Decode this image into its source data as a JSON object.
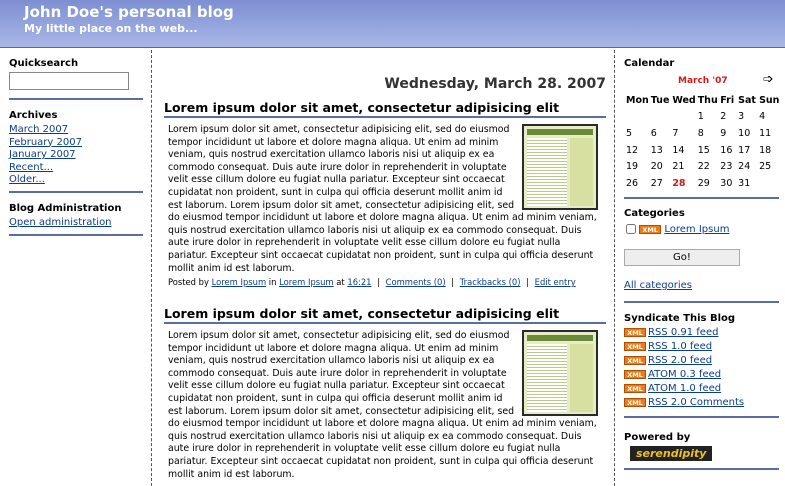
{
  "header": {
    "title": "John Doe's personal blog",
    "description": "My little place on the web..."
  },
  "left": {
    "quicksearch_title": "Quicksearch",
    "search_value": "",
    "archives_title": "Archives",
    "archives": [
      "March 2007",
      "February 2007",
      "January 2007",
      "Recent...",
      "Older..."
    ],
    "admin_title": "Blog Administration",
    "admin_link": "Open administration"
  },
  "main": {
    "date": "Wednesday, March 28. 2007",
    "entries": [
      {
        "title": "Lorem ipsum dolor sit amet, consectetur adipisicing elit",
        "body": "Lorem ipsum dolor sit amet, consectetur adipisicing elit, sed do eiusmod tempor incididunt ut labore et dolore magna aliqua. Ut enim ad minim veniam, quis nostrud exercitation ullamco laboris nisi ut aliquip ex ea commodo consequat. Duis aute irure dolor in reprehenderit in voluptate velit esse cillum dolore eu fugiat nulla pariatur. Excepteur sint occaecat cupidatat non proident, sunt in culpa qui officia deserunt mollit anim id est laborum. Lorem ipsum dolor sit amet, consectetur adipisicing elit, sed do eiusmod tempor incididunt ut labore et dolore magna aliqua. Ut enim ad minim veniam, quis nostrud exercitation ullamco laboris nisi ut aliquip ex ea commodo consequat. Duis aute irure dolor in reprehenderit in voluptate velit esse cillum dolore eu fugiat nulla pariatur. Excepteur sint occaecat cupidatat non proident, sunt in culpa qui officia deserunt mollit anim id est laborum.",
        "footer": {
          "posted_by": "Posted by",
          "author": "Lorem Ipsum",
          "in": "in",
          "category": "Lorem Ipsum",
          "at": "at",
          "time": "16:21",
          "comments": "Comments (0)",
          "trackbacks": "Trackbacks (0)",
          "edit": "Edit entry"
        }
      },
      {
        "title": "Lorem ipsum dolor sit amet, consectetur adipisicing elit",
        "body": "Lorem ipsum dolor sit amet, consectetur adipisicing elit, sed do eiusmod tempor incididunt ut labore et dolore magna aliqua. Ut enim ad minim veniam, quis nostrud exercitation ullamco laboris nisi ut aliquip ex ea commodo consequat. Duis aute irure dolor in reprehenderit in voluptate velit esse cillum dolore eu fugiat nulla pariatur. Excepteur sint occaecat cupidatat non proident, sunt in culpa qui officia deserunt mollit anim id est laborum. Lorem ipsum dolor sit amet, consectetur adipisicing elit, sed do eiusmod tempor incididunt ut labore et dolore magna aliqua. Ut enim ad minim veniam, quis nostrud exercitation ullamco laboris nisi ut aliquip ex ea commodo consequat. Duis aute irure dolor in reprehenderit in voluptate velit esse cillum dolore eu fugiat nulla pariatur. Excepteur sint occaecat cupidatat non proident, sunt in culpa qui officia deserunt mollit anim id est laborum."
      }
    ]
  },
  "right": {
    "calendar_title": "Calendar",
    "calendar_month": "March '07",
    "next_icon": "arrow-right-icon",
    "weekdays": [
      "Mon",
      "Tue",
      "Wed",
      "Thu",
      "Fri",
      "Sat",
      "Sun"
    ],
    "weeks": [
      [
        "",
        "",
        "",
        "1",
        "2",
        "3",
        "4"
      ],
      [
        "5",
        "6",
        "7",
        "8",
        "9",
        "10",
        "11"
      ],
      [
        "12",
        "13",
        "14",
        "15",
        "16",
        "17",
        "18"
      ],
      [
        "19",
        "20",
        "21",
        "22",
        "23",
        "24",
        "25"
      ],
      [
        "26",
        "27",
        "28",
        "29",
        "30",
        "31",
        ""
      ]
    ],
    "today": "28",
    "categories_title": "Categories",
    "category_badge": "XML",
    "category_item": "Lorem Ipsum",
    "go_button": "Go!",
    "all_categories": "All categories",
    "syndicate_title": "Syndicate This Blog",
    "feeds": [
      "RSS 0.91 feed",
      "RSS 1.0 feed",
      "RSS 2.0 feed",
      "ATOM 0.3 feed",
      "ATOM 1.0 feed",
      "RSS 2.0 Comments"
    ],
    "powered_title": "Powered by",
    "powered_logo": "serendipity"
  },
  "colors": {
    "header_gradient_top": "#7d8fd2",
    "header_gradient_bottom": "#a9b6e6",
    "rule": "#5a6ea5",
    "link": "#0a3d91",
    "today": "#d21a1a",
    "xml_badge": "#f07a1a"
  }
}
